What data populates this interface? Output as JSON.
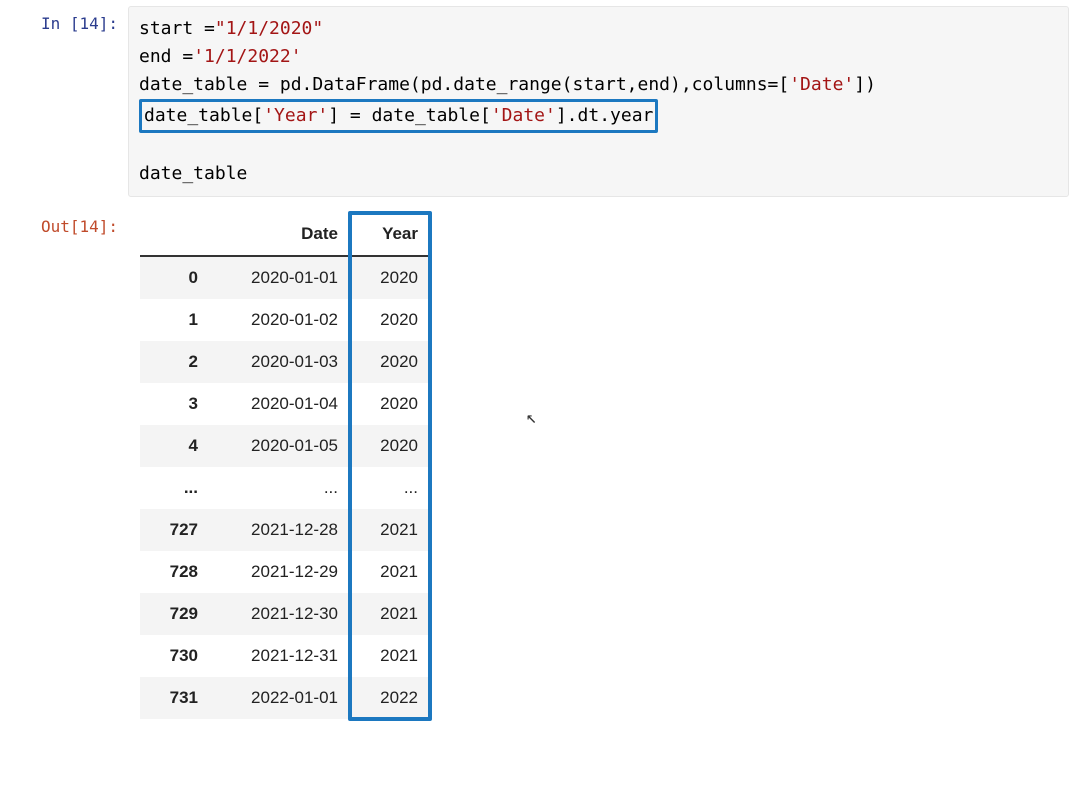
{
  "in_prompt": "In [14]:",
  "out_prompt": "Out[14]:",
  "code": {
    "l1_a": "start =",
    "l1_s": "\"1/1/2020\"",
    "l2_a": "end =",
    "l2_s": "'1/1/2022'",
    "l3_a": "date_table = pd.DataFrame(pd.date_range(start,end),columns=[",
    "l3_s": "'Date'",
    "l3_c": "])",
    "l4_a": "date_table[",
    "l4_s1": "'Year'",
    "l4_b": "] = date_table[",
    "l4_s2": "'Date'",
    "l4_c": "].dt.year",
    "l5": "date_table"
  },
  "table": {
    "columns": [
      "Date",
      "Year"
    ],
    "rows": [
      {
        "idx": "0",
        "date": "2020-01-01",
        "year": "2020"
      },
      {
        "idx": "1",
        "date": "2020-01-02",
        "year": "2020"
      },
      {
        "idx": "2",
        "date": "2020-01-03",
        "year": "2020"
      },
      {
        "idx": "3",
        "date": "2020-01-04",
        "year": "2020"
      },
      {
        "idx": "4",
        "date": "2020-01-05",
        "year": "2020"
      },
      {
        "idx": "...",
        "date": "...",
        "year": "..."
      },
      {
        "idx": "727",
        "date": "2021-12-28",
        "year": "2021"
      },
      {
        "idx": "728",
        "date": "2021-12-29",
        "year": "2021"
      },
      {
        "idx": "729",
        "date": "2021-12-30",
        "year": "2021"
      },
      {
        "idx": "730",
        "date": "2021-12-31",
        "year": "2021"
      },
      {
        "idx": "731",
        "date": "2022-01-01",
        "year": "2022"
      }
    ]
  }
}
